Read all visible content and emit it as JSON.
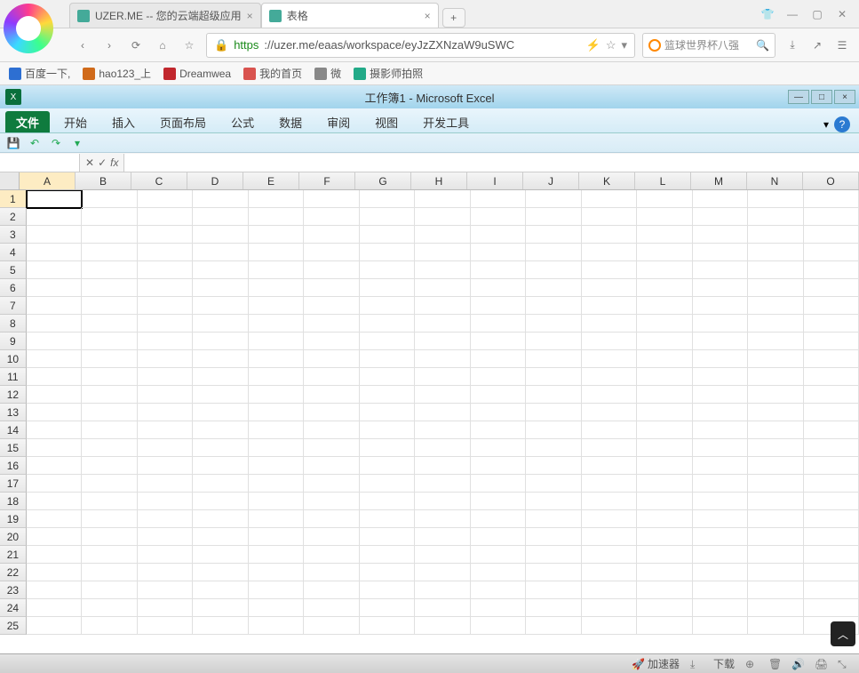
{
  "browser": {
    "tabs": [
      {
        "title": "UZER.ME -- 您的云端超级应用"
      },
      {
        "title": "表格"
      }
    ],
    "window_controls": [
      "skin",
      "min",
      "restore",
      "close"
    ],
    "nav": {
      "back": "‹",
      "forward": "›",
      "reload": "⟳",
      "home": "⌂",
      "lock": "🔒"
    },
    "url": {
      "proto": "https",
      "rest": "://uzer.me/eaas/workspace/eyJzZXNzaW9uSWC"
    },
    "addr_icons": [
      "⚡",
      "☆",
      "▾"
    ],
    "search_placeholder": "篮球世界杯八强",
    "toolbar_right": [
      "⤓",
      "↗",
      "☰"
    ]
  },
  "bookmarks": [
    {
      "label": "百度一下,",
      "color": "#2d6fd2"
    },
    {
      "label": "hao123_上",
      "color": "#d06a1a"
    },
    {
      "label": "Dreamwea",
      "color": "#c1272d"
    },
    {
      "label": "我的首页",
      "color": "#d9534f"
    },
    {
      "label": "微",
      "color": "#888"
    },
    {
      "label": "摄影师拍照",
      "color": "#2a8"
    }
  ],
  "excel": {
    "title": "工作簿1 - Microsoft Excel",
    "app_icon_label": "X",
    "window_buttons": [
      "—",
      "□",
      "×"
    ],
    "ribbon_tabs": [
      "文件",
      "开始",
      "插入",
      "页面布局",
      "公式",
      "数据",
      "审阅",
      "视图",
      "开发工具"
    ],
    "help_down": "▾",
    "help_q": "?",
    "qat": [
      "save",
      "undo",
      "redo",
      "more"
    ],
    "namebox_value": "",
    "fx_buttons": [
      "✕",
      "✓",
      "fx"
    ],
    "formula_value": "",
    "columns": [
      "A",
      "B",
      "C",
      "D",
      "E",
      "F",
      "G",
      "H",
      "I",
      "J",
      "K",
      "L",
      "M",
      "N",
      "O"
    ],
    "row_count": 25,
    "active_cell": {
      "col": "A",
      "row": 1
    },
    "scroll_up": "︿"
  },
  "status": {
    "items": [
      {
        "icon": "🚀",
        "label": "加速器"
      },
      {
        "icon": "⤓",
        "label": ""
      },
      {
        "icon": "",
        "label": "下载"
      },
      {
        "icon": "⊕",
        "label": ""
      },
      {
        "icon": "🗑",
        "label": ""
      },
      {
        "icon": "🔊",
        "label": ""
      },
      {
        "icon": "🖨",
        "label": ""
      },
      {
        "icon": "⤡",
        "label": ""
      }
    ]
  }
}
